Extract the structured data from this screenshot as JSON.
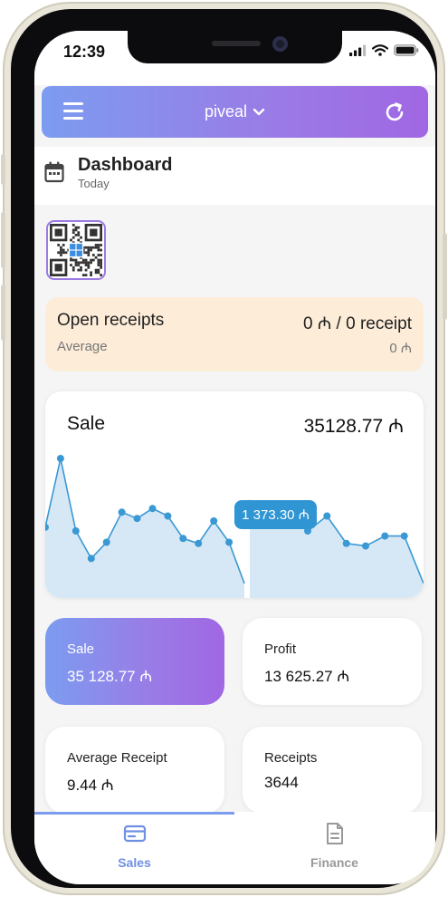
{
  "status": {
    "time": "12:39"
  },
  "appbar": {
    "title": "piveal"
  },
  "dashboard": {
    "title": "Dashboard",
    "subtitle": "Today"
  },
  "open_receipts": {
    "title": "Open receipts",
    "value": "0 ₼ / 0 receipt",
    "sub_label": "Average",
    "sub_value": "0 ₼"
  },
  "sale_card": {
    "title": "Sale",
    "total": "35128.77 ₼",
    "tooltip": "1 373.30 ₼"
  },
  "chart_data": {
    "type": "area",
    "title": "Sale",
    "series": [
      {
        "values": [
          45,
          100,
          42,
          20,
          33,
          57,
          52,
          60,
          54,
          36,
          32,
          50,
          33,
          0
        ]
      },
      {
        "values": [
          64,
          54,
          55,
          42,
          54,
          32,
          30,
          38,
          38,
          0
        ]
      }
    ],
    "note_values": [
      1373.3
    ],
    "fill": "#d6e8f5",
    "line": "#3a98d4"
  },
  "stats": [
    {
      "label": "Sale",
      "value": "35 128.77 ₼"
    },
    {
      "label": "Profit",
      "value": "13 625.27 ₼"
    },
    {
      "label": "Average Receipt",
      "value": "9.44 ₼"
    },
    {
      "label": "Receipts",
      "value": "3644"
    }
  ],
  "nav": [
    {
      "label": "Sales",
      "active": true
    },
    {
      "label": "Finance",
      "active": false
    }
  ],
  "colors": {
    "accent": "#7c9cf0",
    "accent_end": "#a067e3",
    "receipts_bg": "#fdecd8",
    "chart_line": "#3a98d4"
  }
}
